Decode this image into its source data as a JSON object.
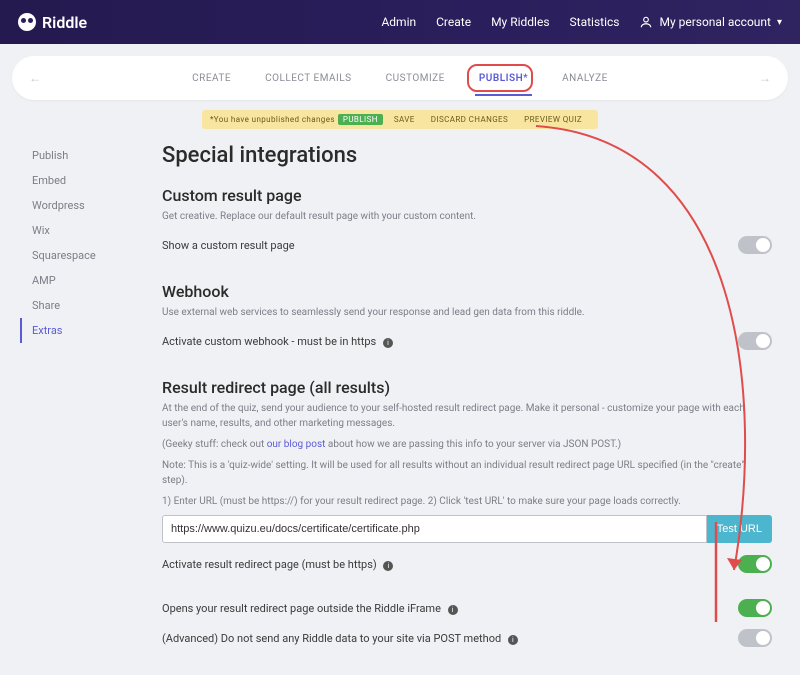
{
  "brand": "Riddle",
  "nav": {
    "admin": "Admin",
    "create": "Create",
    "myriddles": "My Riddles",
    "statistics": "Statistics",
    "account": "My personal account"
  },
  "steps": {
    "create": "CREATE",
    "collect": "COLLECT EMAILS",
    "customize": "CUSTOMIZE",
    "publish": "PUBLISH*",
    "analyze": "ANALYZE"
  },
  "warn": {
    "prefix": "*You have unpublished changes",
    "publish": "PUBLISH",
    "save": "SAVE",
    "discard": "DISCARD CHANGES",
    "preview": "PREVIEW QUIZ"
  },
  "sidebar": {
    "items": [
      "Publish",
      "Embed",
      "Wordpress",
      "Wix",
      "Squarespace",
      "AMP",
      "Share",
      "Extras"
    ]
  },
  "main": {
    "title": "Special integrations",
    "custom": {
      "heading": "Custom result page",
      "help": "Get creative. Replace our default result page with your custom content.",
      "toggle_label": "Show a custom result page"
    },
    "webhook": {
      "heading": "Webhook",
      "help": "Use external web services to seamlessly send your response and lead gen data from this riddle.",
      "toggle_label": "Activate custom webhook - must be in https"
    },
    "redirect": {
      "heading": "Result redirect page (all results)",
      "help1": "At the end of the quiz, send your audience to your self-hosted result redirect page. Make it personal - customize your page with each user's name, results, and other marketing messages.",
      "help2_prefix": "(Geeky stuff: check out ",
      "help2_link": "our blog post",
      "help2_suffix": " about how we are passing this info to your server via JSON POST.)",
      "help3": "Note: This is a 'quiz-wide' setting. It will be used for all results without an individual result redirect page URL specified (in the \"create\" step).",
      "help4": "1) Enter URL (must be https://) for your result redirect page. 2) Click 'test URL' to make sure your page loads correctly.",
      "url_value": "https://www.quizu.eu/docs/certificate/certificate.php",
      "test_label": "Test URL",
      "activate_label": "Activate result redirect page (must be https)",
      "outside_label": "Opens your result redirect page outside the Riddle iFrame",
      "advanced_label": "(Advanced) Do not send any Riddle data to your site via POST method"
    }
  }
}
